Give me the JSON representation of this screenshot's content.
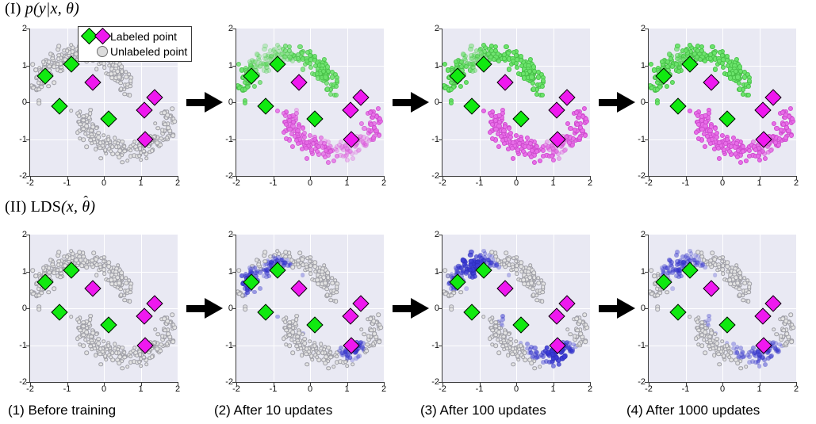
{
  "figure": {
    "rows": [
      {
        "id": "row-prob",
        "title_plain": "(I) p(y|x, θ̂)",
        "roman": "(I)",
        "func": "p",
        "args_pre": "(y|x, ",
        "theta": "θ",
        "hat": "ˆ",
        "args_post": ")"
      },
      {
        "id": "row-lds",
        "title_plain": "(II) LDS(x, θ̂)",
        "roman": "(II)",
        "func": "LDS",
        "args_pre": "(x, ",
        "theta": "θ",
        "hat": "ˆ",
        "args_post": ")"
      }
    ],
    "columns": [
      {
        "caption": "(1) Before training"
      },
      {
        "caption": "(2) After 10 updates"
      },
      {
        "caption": "(3) After 100 updates"
      },
      {
        "caption": "(4) After 1000 updates"
      }
    ],
    "arrows": {
      "count": 6,
      "glyph": "right-arrow",
      "color": "#000000"
    }
  },
  "legend": {
    "labeled_text": "Labeled point",
    "unlabeled_text": "Unlabeled point",
    "labeled_swatches": [
      "#10ea10",
      "#ef18ef"
    ],
    "unlabeled_swatch": "#dcdcdc"
  },
  "axes": {
    "x_ticks": [
      "-2",
      "-1",
      "0",
      "1",
      "2"
    ],
    "y_ticks": [
      "2",
      "1",
      "0",
      "-1",
      "-2"
    ],
    "xlim": [
      -2,
      2
    ],
    "ylim": [
      -2,
      2
    ],
    "background": "#e9e9f3",
    "gridline_color": "#ffffff"
  },
  "colors": {
    "green": "#10ea10",
    "magenta": "#ef18ef",
    "unlabeled": "#e3e3e3",
    "blue": "#3a3ad6",
    "panel_bg": "#e9e9f3"
  },
  "chart_data": {
    "type": "scatter",
    "title": "Two-moons semi-supervised learning: predicted label distribution and local distributional smoothing over training",
    "xlabel": "",
    "ylabel": "",
    "xlim": [
      -2,
      2
    ],
    "ylim": [
      -2,
      2
    ],
    "grid": true,
    "legend_position": "top-right of panel (I)(1)",
    "labeled_points": [
      {
        "x": -1.6,
        "y": 0.72,
        "class": "green"
      },
      {
        "x": -0.88,
        "y": 1.03,
        "class": "green"
      },
      {
        "x": -1.2,
        "y": -0.1,
        "class": "green"
      },
      {
        "x": 0.12,
        "y": -0.45,
        "class": "green"
      },
      {
        "x": -0.31,
        "y": 0.54,
        "class": "magenta"
      },
      {
        "x": 1.38,
        "y": 0.12,
        "class": "magenta"
      },
      {
        "x": 1.1,
        "y": -0.22,
        "class": "magenta"
      },
      {
        "x": 1.12,
        "y": -1.0,
        "class": "magenta"
      }
    ],
    "panels": [
      {
        "row": "(I)",
        "col": "(1)",
        "caption": "(1) Before training",
        "point_coloring": "all unlabeled (gray)",
        "n_unlabeled": 420
      },
      {
        "row": "(I)",
        "col": "(2)",
        "caption": "(2) After 10 updates",
        "point_coloring": "green/magenta predicted, partly uncertain near boundary",
        "n_unlabeled": 420
      },
      {
        "row": "(I)",
        "col": "(3)",
        "caption": "(3) After 100 updates",
        "point_coloring": "green/magenta predicted, more confident",
        "n_unlabeled": 420
      },
      {
        "row": "(I)",
        "col": "(4)",
        "caption": "(4) After 1000 updates",
        "point_coloring": "green/magenta fully separated along the two moons",
        "n_unlabeled": 420
      },
      {
        "row": "(II)",
        "col": "(1)",
        "caption": "(1) Before training",
        "point_coloring": "all gray, LDS ~ 0 everywhere",
        "n_unlabeled": 420
      },
      {
        "row": "(II)",
        "col": "(2)",
        "caption": "(2) After 10 updates",
        "point_coloring": "blue LDS concentrated near labeled points",
        "n_unlabeled": 420
      },
      {
        "row": "(II)",
        "col": "(3)",
        "caption": "(3) After 100 updates",
        "point_coloring": "blue LDS spread over the central boundary region",
        "n_unlabeled": 420
      },
      {
        "row": "(II)",
        "col": "(4)",
        "caption": "(4) After 1000 updates",
        "point_coloring": "faint diffuse blue, LDS nearly vanished",
        "n_unlabeled": 420
      }
    ]
  }
}
